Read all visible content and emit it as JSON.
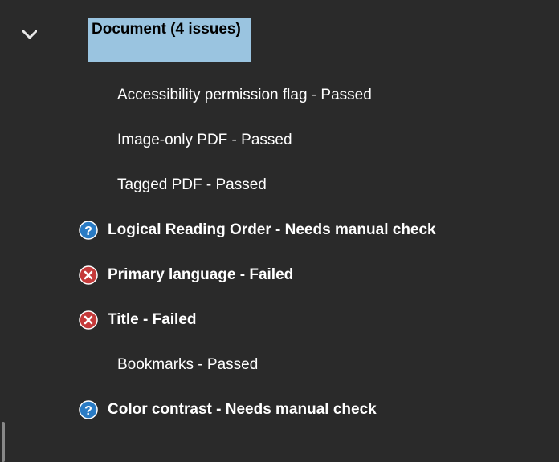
{
  "section": {
    "title": "Document (4 issues)"
  },
  "items": [
    {
      "label": "Accessibility permission flag - Passed",
      "status": "passed",
      "icon": "none",
      "bold": false
    },
    {
      "label": "Image-only PDF - Passed",
      "status": "passed",
      "icon": "none",
      "bold": false
    },
    {
      "label": "Tagged PDF - Passed",
      "status": "passed",
      "icon": "none",
      "bold": false
    },
    {
      "label": "Logical Reading Order - Needs manual check",
      "status": "manual",
      "icon": "question",
      "bold": true
    },
    {
      "label": "Primary language - Failed",
      "status": "failed",
      "icon": "error",
      "bold": true
    },
    {
      "label": "Title - Failed",
      "status": "failed",
      "icon": "error",
      "bold": true
    },
    {
      "label": "Bookmarks - Passed",
      "status": "passed",
      "icon": "none",
      "bold": false
    },
    {
      "label": "Color contrast - Needs manual check",
      "status": "manual",
      "icon": "question",
      "bold": true
    }
  ]
}
